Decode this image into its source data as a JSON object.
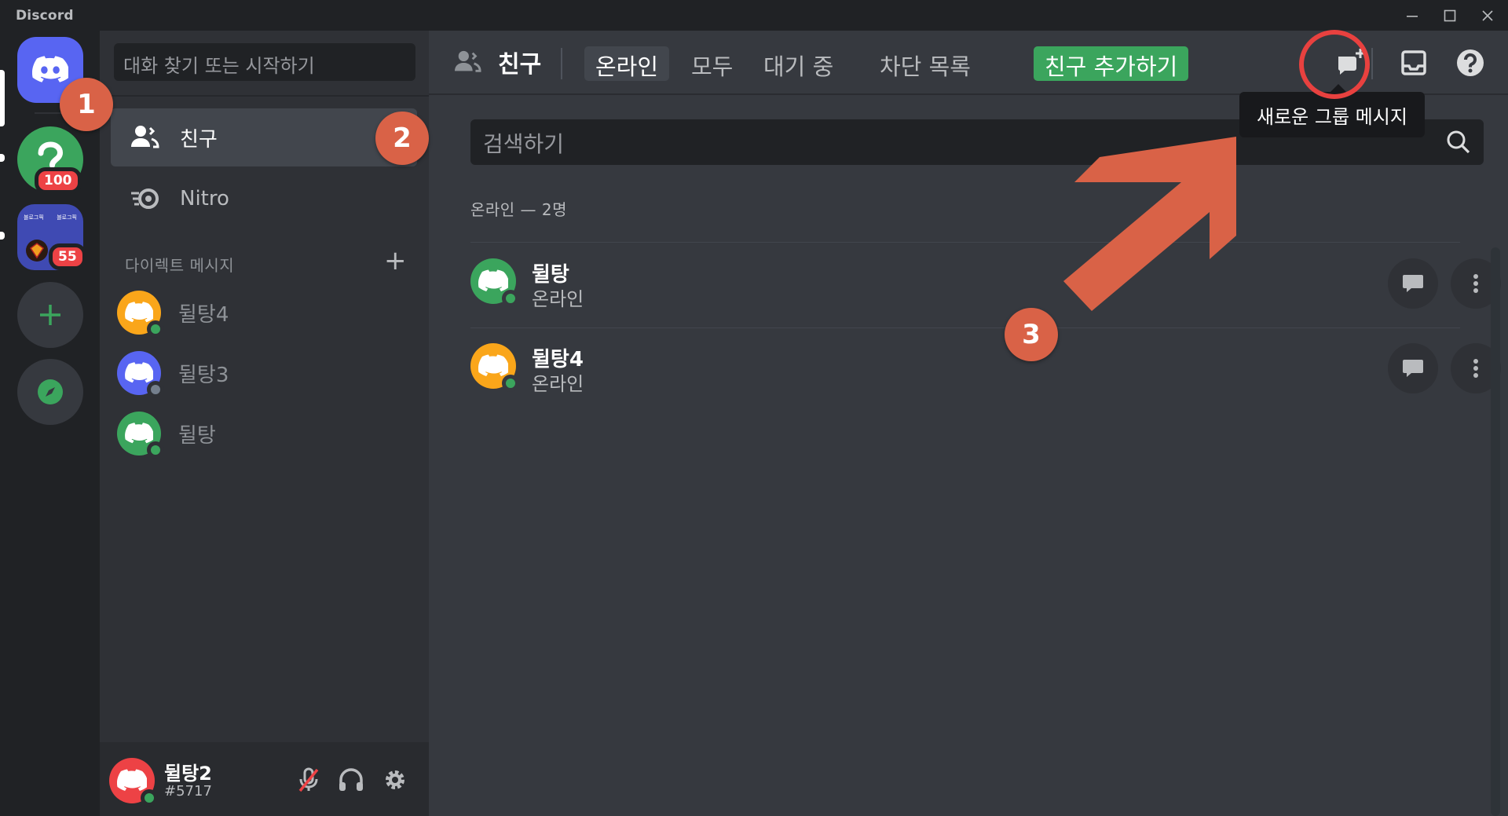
{
  "app": {
    "title": "Discord"
  },
  "window_controls": {
    "minimize": "—",
    "maximize": "☐",
    "close": "✕"
  },
  "rail": {
    "servers": [
      {
        "name": "server-quiz",
        "badge": "100",
        "color": "#3ba55d"
      },
      {
        "name": "server-blog",
        "badge": "55",
        "color": "#3f4ab3",
        "tile_text": "블로그픽"
      }
    ],
    "add_server_icon": "plus-icon",
    "explore_icon": "compass-icon"
  },
  "sidebar": {
    "search_placeholder": "대화 찾기 또는 시작하기",
    "nav": [
      {
        "label": "친구",
        "icon": "friends-icon"
      },
      {
        "label": "Nitro",
        "icon": "nitro-icon"
      }
    ],
    "dm_header": "다이렉트 메시지",
    "dms": [
      {
        "name": "뒬탕4",
        "avatar_color": "#faa61a",
        "status": "online"
      },
      {
        "name": "뒬탕3",
        "avatar_color": "#5865f2",
        "status": "offline"
      },
      {
        "name": "뒬탕",
        "avatar_color": "#3ba55d",
        "status": "online"
      }
    ]
  },
  "user_panel": {
    "name": "뒬탕2",
    "tag": "#5717",
    "avatar_color": "#ed4245"
  },
  "topbar": {
    "title": "친구",
    "tabs": [
      "온라인",
      "모두",
      "대기 중",
      "차단 목록"
    ],
    "add_friend": "친구 추가하기",
    "tooltip": "새로운 그룹 메시지"
  },
  "main": {
    "search_placeholder": "검색하기",
    "section_label": "온라인 — 2명",
    "friends": [
      {
        "name": "뒬탕",
        "status": "온라인",
        "avatar_color": "#3ba55d"
      },
      {
        "name": "뒬탕4",
        "status": "온라인",
        "avatar_color": "#faa61a"
      }
    ]
  },
  "annotations": {
    "step1": "1",
    "step2": "2",
    "step3": "3"
  },
  "colors": {
    "blurple": "#5865f2",
    "green": "#3ba55d",
    "red": "#ed4245",
    "annotation": "#d96247"
  }
}
